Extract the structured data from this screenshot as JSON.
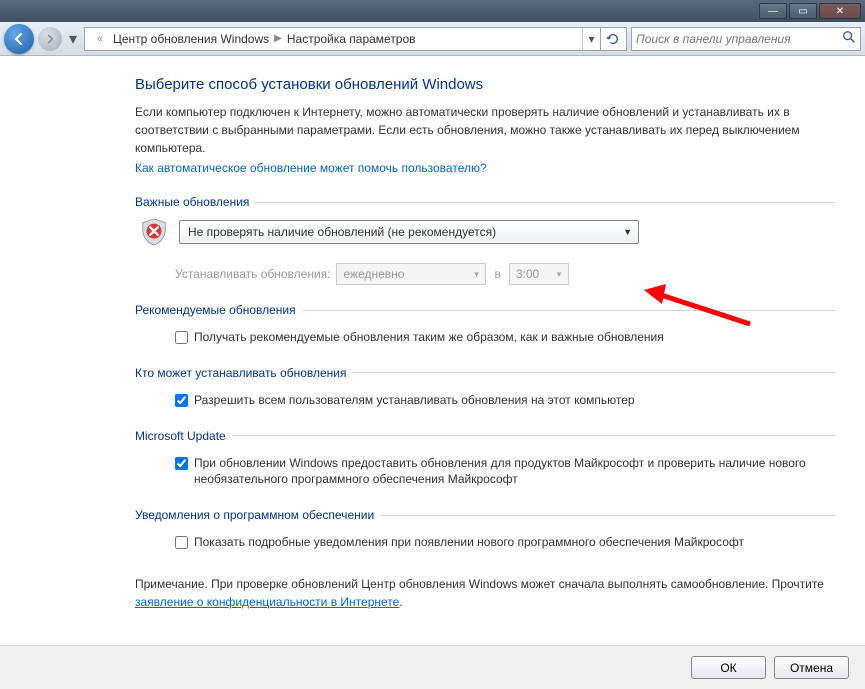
{
  "titlebar": {
    "min": "—",
    "max": "▭",
    "close": "✕"
  },
  "nav": {
    "breadcrumb_prefix": "«",
    "breadcrumb1": "Центр обновления Windows",
    "breadcrumb2": "Настройка параметров",
    "search_placeholder": "Поиск в панели управления"
  },
  "main": {
    "heading": "Выберите способ установки обновлений Windows",
    "intro": "Если компьютер подключен к Интернету, можно автоматически проверять наличие обновлений и устанавливать их в соответствии с выбранными параметрами. Если есть обновления, можно также устанавливать их перед выключением компьютера.",
    "help_link": "Как автоматическое обновление может помочь пользователю?"
  },
  "important": {
    "legend": "Важные обновления",
    "selected": "Не проверять наличие обновлений (не рекомендуется)",
    "schedule_label": "Устанавливать обновления:",
    "day": "ежедневно",
    "at": "в",
    "time": "3:00"
  },
  "recommended": {
    "legend": "Рекомендуемые обновления",
    "cb_label": "Получать рекомендуемые обновления таким же образом, как и важные обновления",
    "cb_checked": false
  },
  "who": {
    "legend": "Кто может устанавливать обновления",
    "cb_label": "Разрешить всем пользователям устанавливать обновления на этот компьютер",
    "cb_checked": true
  },
  "msupdate": {
    "legend": "Microsoft Update",
    "cb_label": "При обновлении Windows предоставить обновления для продуктов Майкрософт и проверить наличие нового необязательного программного обеспечения Майкрософт",
    "cb_checked": true
  },
  "notify": {
    "legend": "Уведомления о программном обеспечении",
    "cb_label": "Показать подробные уведомления при появлении нового программного обеспечения Майкрософт",
    "cb_checked": false
  },
  "note": {
    "prefix": "Примечание. При проверке обновлений Центр обновления Windows может сначала выполнять самообновление. Прочтите ",
    "link": "заявление о конфиденциальности в Интернете",
    "suffix": "."
  },
  "footer": {
    "ok": "ОК",
    "cancel": "Отмена"
  }
}
